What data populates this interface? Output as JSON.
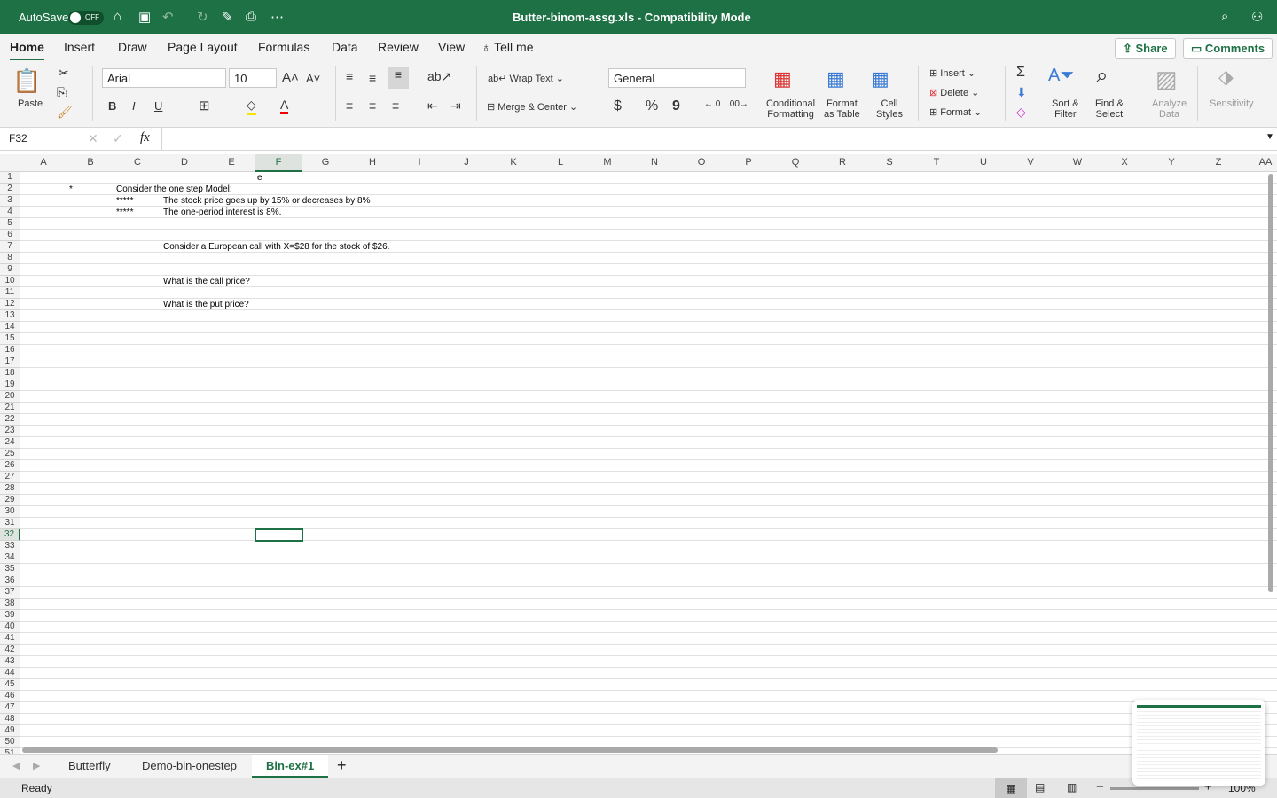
{
  "titlebar": {
    "autosave": "AutoSave",
    "toggle": "OFF",
    "title": "Butter-binom-assg.xls  -  Compatibility Mode"
  },
  "tabs": [
    "Home",
    "Insert",
    "Draw",
    "Page Layout",
    "Formulas",
    "Data",
    "Review",
    "View",
    "Tell me"
  ],
  "share": "Share",
  "comments": "Comments",
  "ribbon": {
    "paste": "Paste",
    "font": "Arial",
    "size": "10",
    "wrap": "Wrap Text",
    "merge": "Merge & Center",
    "numfmt": "General",
    "cond1": "Conditional",
    "cond2": "Formatting",
    "fmt1": "Format",
    "fmt2": "as Table",
    "cell1": "Cell",
    "cell2": "Styles",
    "insert": "Insert",
    "delete": "Delete",
    "format": "Format",
    "sort1": "Sort &",
    "sort2": "Filter",
    "find1": "Find &",
    "find2": "Select",
    "an1": "Analyze",
    "an2": "Data",
    "sens": "Sensitivity",
    "bold": "B",
    "italic": "I",
    "underline": "U",
    "dollar": "$",
    "percent": "%",
    "comma": "9"
  },
  "formula": {
    "namebox": "F32",
    "fx": "fx",
    "value": ""
  },
  "columns": [
    "A",
    "B",
    "C",
    "D",
    "E",
    "F",
    "G",
    "H",
    "I",
    "J",
    "K",
    "L",
    "M",
    "N",
    "O",
    "P",
    "Q",
    "R",
    "S",
    "T",
    "U",
    "V",
    "W",
    "X",
    "Y",
    "Z",
    "AA"
  ],
  "selected": {
    "col": "F",
    "row": 32
  },
  "cells": [
    {
      "ref": "F1",
      "col": 5,
      "row": 1,
      "text": "e"
    },
    {
      "ref": "B2",
      "col": 1,
      "row": 2,
      "text": "*"
    },
    {
      "ref": "C2",
      "col": 2,
      "row": 2,
      "text": "Consider the one step Model:"
    },
    {
      "ref": "C3",
      "col": 2,
      "row": 3,
      "text": "*****"
    },
    {
      "ref": "D3",
      "col": 3,
      "row": 3,
      "text": "The stock price goes up by 15% or decreases by 8%"
    },
    {
      "ref": "C4",
      "col": 2,
      "row": 4,
      "text": "*****"
    },
    {
      "ref": "D4",
      "col": 3,
      "row": 4,
      "text": "The one-period interest is 8%."
    },
    {
      "ref": "D7",
      "col": 3,
      "row": 7,
      "text": "Consider a European call with X=$28 for the stock of $26."
    },
    {
      "ref": "D10",
      "col": 3,
      "row": 10,
      "text": "What is the call price?"
    },
    {
      "ref": "D12",
      "col": 3,
      "row": 12,
      "text": "What is the put price?"
    }
  ],
  "sheets": [
    "Butterfly",
    "Demo-bin-onestep",
    "Bin-ex#1"
  ],
  "active_sheet": "Bin-ex#1",
  "status": {
    "ready": "Ready",
    "zoom": "100%"
  },
  "accent": "#1e7145"
}
